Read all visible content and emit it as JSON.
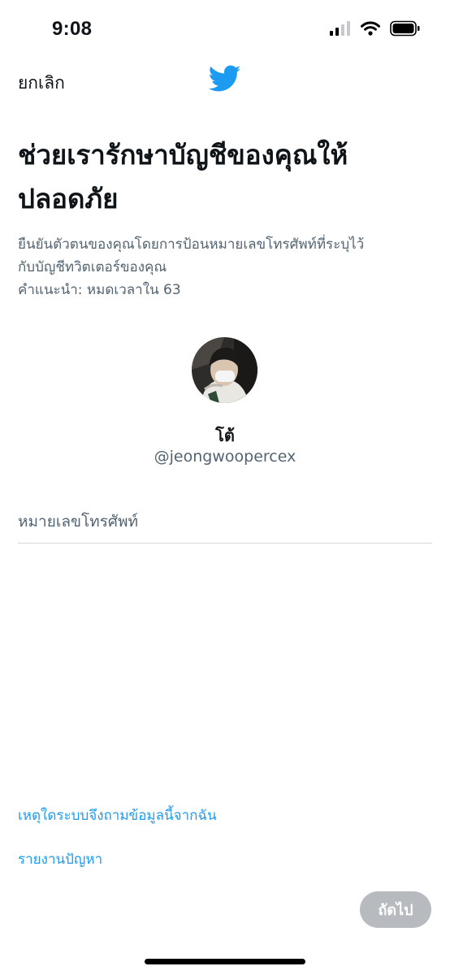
{
  "status_bar": {
    "time": "9:08"
  },
  "header": {
    "cancel_label": "ยกเลิก",
    "logo_icon": "twitter-bird-icon",
    "brand_color": "#1d9bf0"
  },
  "main": {
    "title": "ช่วยเรารักษาบัญชีของคุณให้ปลอดภัย",
    "description_lines": [
      "ยืนยันตัวตนของคุณโดยการป้อนหมายเลขโทรศัพท์ที่ระบุไว้",
      "กับบัญชีทวิตเตอร์ของคุณ",
      "คำแนะนำ: หมดเวลาใน 63"
    ],
    "user": {
      "display_name": "โต้",
      "handle": "@jeongwoopercex"
    },
    "phone_input": {
      "placeholder": "หมายเลขโทรศัพท์",
      "value": ""
    }
  },
  "footer": {
    "why_link": "เหตุใดระบบจึงถามข้อมูลนี้จากฉัน",
    "report_link": "รายงานปัญหา",
    "next_label": "ถัดไป"
  }
}
